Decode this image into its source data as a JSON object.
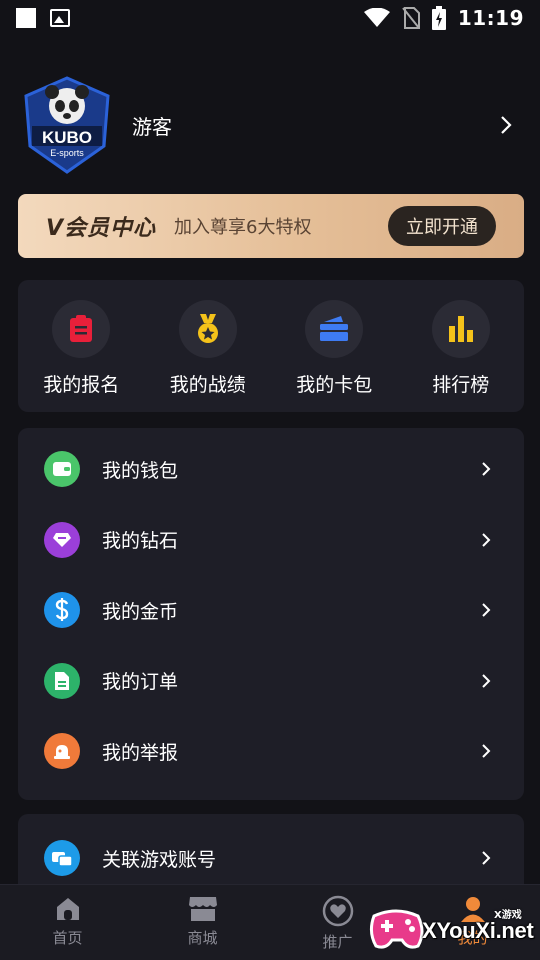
{
  "status_bar": {
    "time": "11:19"
  },
  "profile": {
    "username": "游客",
    "avatar_text": "KUBO",
    "avatar_subtext": "E-sports"
  },
  "vip_banner": {
    "logo": "V会员中心",
    "description": "加入尊享6大特权",
    "button": "立即开通"
  },
  "quick_actions": [
    {
      "label": "我的报名",
      "icon": "clipboard-icon",
      "color": "#e8203a"
    },
    {
      "label": "我的战绩",
      "icon": "medal-icon",
      "color": "#f4c21a"
    },
    {
      "label": "我的卡包",
      "icon": "card-wallet-icon",
      "color": "#3e7bf2"
    },
    {
      "label": "排行榜",
      "icon": "bar-chart-icon",
      "color": "#f4c21a"
    }
  ],
  "menu": [
    {
      "label": "我的钱包",
      "icon": "wallet-icon",
      "color": "#4ac56a"
    },
    {
      "label": "我的钻石",
      "icon": "diamond-icon",
      "color": "#9b3fd9"
    },
    {
      "label": "我的金币",
      "icon": "dollar-icon",
      "color": "#1f93ea"
    },
    {
      "label": "我的订单",
      "icon": "document-icon",
      "color": "#2db36a"
    },
    {
      "label": "我的举报",
      "icon": "alarm-icon",
      "color": "#f07a3a"
    }
  ],
  "menu2": [
    {
      "label": "关联游戏账号",
      "icon": "link-account-icon",
      "color": "#1d9be8"
    }
  ],
  "tabbar": [
    {
      "label": "首页",
      "icon": "home-icon"
    },
    {
      "label": "商城",
      "icon": "store-icon"
    },
    {
      "label": "推广",
      "icon": "heart-icon"
    },
    {
      "label": "我的",
      "icon": "profile-icon"
    }
  ],
  "watermark": {
    "text": "XYouXi.net",
    "top_text": "X游戏"
  }
}
